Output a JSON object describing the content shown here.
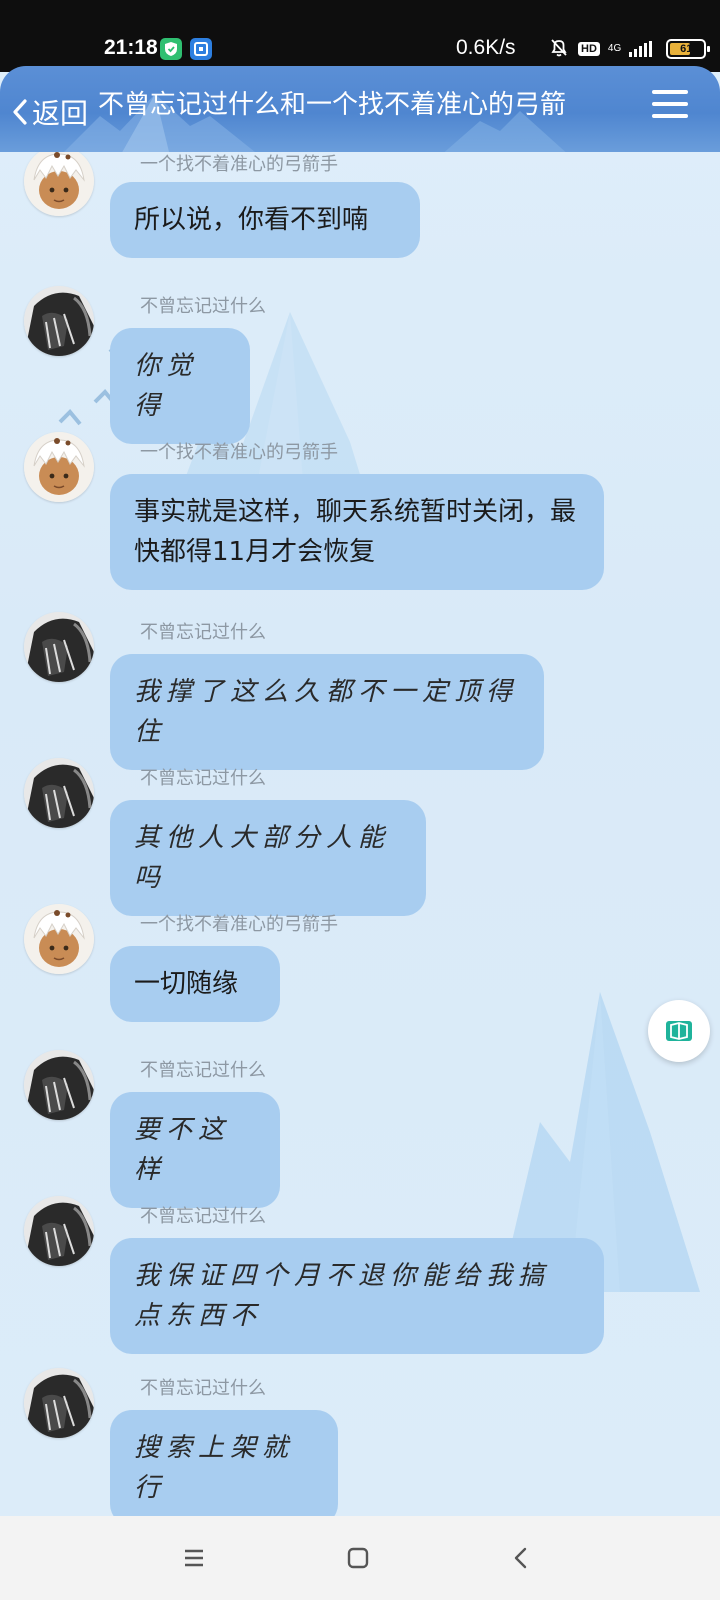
{
  "status_bar": {
    "time": "21:18",
    "network_speed": "0.6K/s",
    "network_type": "4G",
    "hd_label": "HD",
    "battery": "61",
    "icons": [
      "shield-app-icon",
      "app-icon",
      "mute-bell-icon",
      "hd-icon",
      "signal-icon",
      "battery-icon"
    ]
  },
  "header": {
    "back_label": "返回",
    "title": "不曾忘记过什么和一个找不着准心的弓箭",
    "menu_icon": "hamburger-menu-icon"
  },
  "colors": {
    "header": "#5088d0",
    "bubble": "#a8cdf0",
    "background": "#dcecf9",
    "sender_text": "#8d98a3"
  },
  "messages": [
    {
      "sender": "一个找不着准心的弓箭手",
      "avatar": "white-haired-avatar",
      "text": "所以说，你看不到喃",
      "style": "normal"
    },
    {
      "sender": "不曾忘记过什么",
      "avatar": "dark-ink-avatar",
      "text": "你觉得",
      "style": "handwriting"
    },
    {
      "sender": "一个找不着准心的弓箭手",
      "avatar": "white-haired-avatar",
      "text": "事实就是这样，聊天系统暂时关闭，最快都得11月才会恢复",
      "style": "normal"
    },
    {
      "sender": "不曾忘记过什么",
      "avatar": "dark-ink-avatar",
      "text": "我撑了这么久都不一定顶得住",
      "style": "handwriting"
    },
    {
      "sender": "不曾忘记过什么",
      "avatar": "dark-ink-avatar",
      "text": "其他人大部分人能吗",
      "style": "handwriting"
    },
    {
      "sender": "一个找不着准心的弓箭手",
      "avatar": "white-haired-avatar",
      "text": "一切随缘",
      "style": "normal"
    },
    {
      "sender": "不曾忘记过什么",
      "avatar": "dark-ink-avatar",
      "text": "要不这样",
      "style": "handwriting"
    },
    {
      "sender": "不曾忘记过什么",
      "avatar": "dark-ink-avatar",
      "text": "我保证四个月不退你能给我搞点东西不",
      "style": "handwriting"
    },
    {
      "sender": "不曾忘记过什么",
      "avatar": "dark-ink-avatar",
      "text": "搜索上架就行",
      "style": "handwriting"
    }
  ],
  "floating_button": {
    "icon": "cube-app-icon"
  },
  "nav_bar": {
    "icons": [
      "recent-apps-icon",
      "home-icon",
      "back-icon"
    ]
  }
}
